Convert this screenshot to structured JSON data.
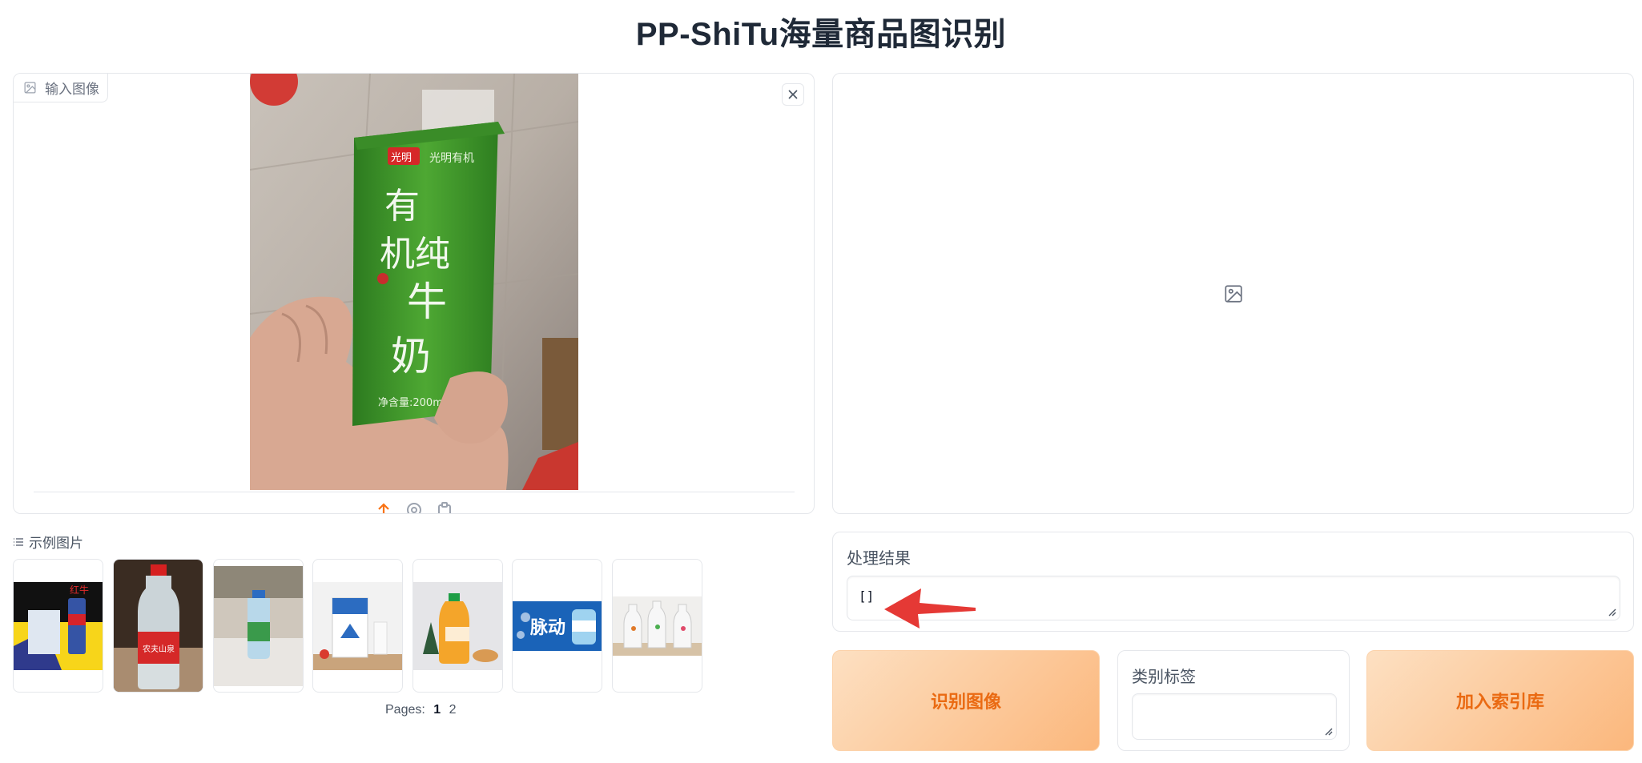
{
  "page": {
    "title": "PP-ShiTu海量商品图识别"
  },
  "input_image": {
    "label": "输入图像",
    "close_icon": "close-icon",
    "toolbar_icons": [
      "upload-icon",
      "webcam-icon",
      "clipboard-icon"
    ]
  },
  "examples": {
    "label": "示例图片",
    "items": [
      {
        "name": "example-red-bull"
      },
      {
        "name": "example-nongfu-water"
      },
      {
        "name": "example-water-bottle-table"
      },
      {
        "name": "example-milk-carton"
      },
      {
        "name": "example-orange-juice"
      },
      {
        "name": "example-maidong-drink"
      },
      {
        "name": "example-soda-bottles"
      }
    ],
    "pagination": {
      "label": "Pages:",
      "pages": [
        "1",
        "2"
      ],
      "current": "1"
    }
  },
  "output_image": {
    "placeholder_icon": "image-icon"
  },
  "result": {
    "label": "处理结果",
    "value": "[]"
  },
  "actions": {
    "recognize_label": "识别图像",
    "category_label": "类别标签",
    "category_value": "",
    "add_index_label": "加入索引库"
  },
  "colors": {
    "accent": "#ea6a12",
    "button_gradient_start": "#fde0c2",
    "button_gradient_end": "#fbb77c",
    "annotation_arrow": "#e53935"
  }
}
